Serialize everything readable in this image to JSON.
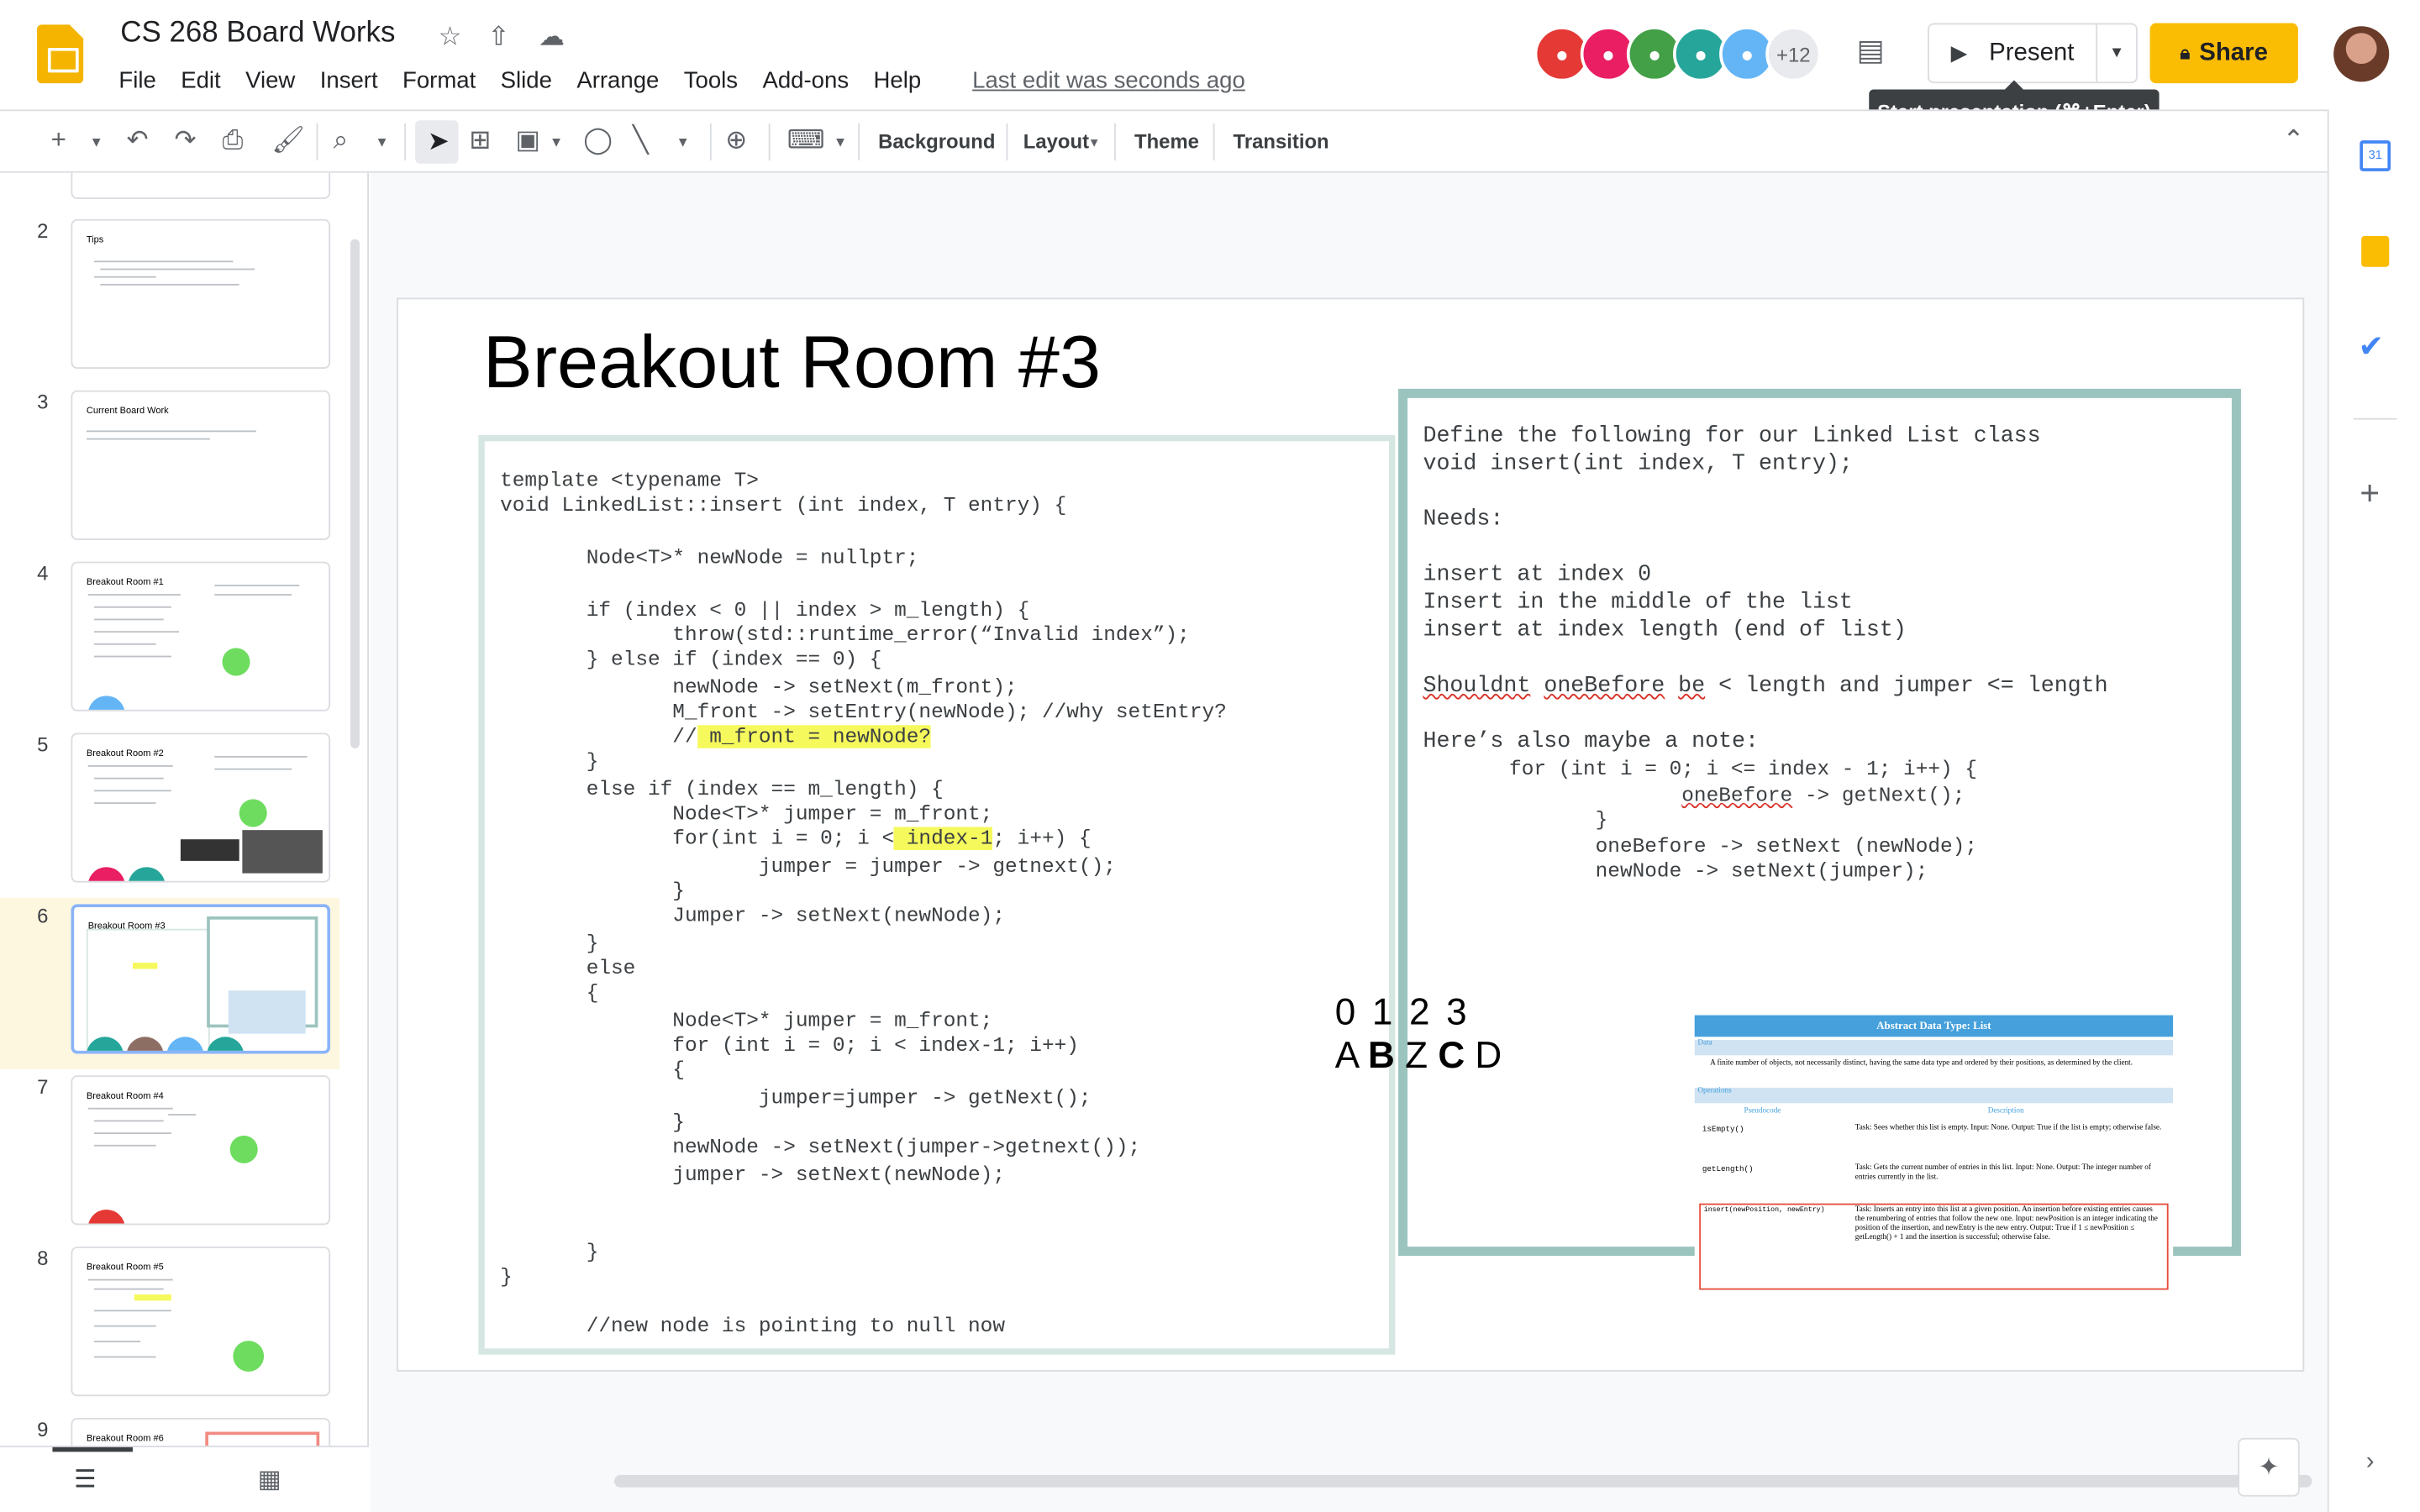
{
  "doc": {
    "title": "CS 268 Board Works",
    "last_edit": "Last edit was seconds ago"
  },
  "menu": [
    "File",
    "Edit",
    "View",
    "Insert",
    "Format",
    "Slide",
    "Arrange",
    "Tools",
    "Add-ons",
    "Help"
  ],
  "collab": {
    "more": "+12",
    "colors": [
      "#e53935",
      "#e91e63",
      "#43a047",
      "#26a69a",
      "#64b5f6"
    ]
  },
  "buttons": {
    "present": "Present",
    "share": "Share",
    "tooltip": "Start presentation (⌘+Enter)"
  },
  "toolbar": {
    "background": "Background",
    "layout": "Layout",
    "theme": "Theme",
    "transition": "Transition"
  },
  "slides": [
    {
      "num": "2",
      "title": "Tips"
    },
    {
      "num": "3",
      "title": "Current Board Work"
    },
    {
      "num": "4",
      "title": "Breakout Room #1"
    },
    {
      "num": "5",
      "title": "Breakout Room #2"
    },
    {
      "num": "6",
      "title": "Breakout Room #3"
    },
    {
      "num": "7",
      "title": "Breakout Room #4"
    },
    {
      "num": "8",
      "title": "Breakout Room #5"
    },
    {
      "num": "9",
      "title": "Breakout Room #6"
    }
  ],
  "slide": {
    "title": "Breakout Room #3",
    "code": [
      "template <typename T>",
      "void LinkedList::insert (int index, T entry) {",
      "",
      "       Node<T>* newNode = nullptr;",
      "",
      "       if (index < 0 || index > m_length) {",
      "              throw(std::runtime_error(“Invalid index”);",
      "       } else if (index == 0) {",
      "              newNode -> setNext(m_front);",
      "              M_front -> setEntry(newNode); //why setEntry?",
      "              //",
      "       }",
      "       else if (index == m_length) {",
      "              Node<T>* jumper = m_front;",
      "              for(int i = 0; i <",
      "                     jumper = jumper -> getnext();",
      "              }",
      "              Jumper -> setNext(newNode);",
      "       }",
      "       else",
      "       {",
      "              Node<T>* jumper = m_front;",
      "              for (int i = 0; i < index-1; i++)",
      "              {",
      "                     jumper=jumper -> getNext();",
      "              }",
      "              newNode -> setNext(jumper->getnext());",
      "              jumper -> setNext(newNode);",
      "",
      "",
      "       }",
      "}",
      "",
      "       //new node is pointing to null now"
    ],
    "hl1": " m_front = newNode?",
    "hl2": " index-1",
    "hl2_after": "; i++) {",
    "right": [
      "Define the following for our Linked List class",
      "void insert(int index, T entry);",
      "",
      "Needs:",
      "",
      "insert at index 0",
      "Insert in the middle of the list",
      "insert at index length (end of list)",
      "",
      "",
      "",
      "Here’s also maybe a note:",
      "       for (int i = 0; i <= index - 1; i++) {",
      "",
      "              }",
      "              oneBefore -> setNext (newNode);",
      "              newNode -> setNext(jumper);"
    ],
    "shouldnt": {
      "a": "Shouldnt",
      "b": " ",
      "c": "oneBefore",
      "d": " ",
      "e": "be",
      "f": " < length and jumper <= length"
    },
    "onebefore_line": {
      "pre": "                     ",
      "word": "oneBefore",
      "post": " -> getNext();"
    },
    "numbers": "0 1 2  3",
    "letters": [
      "A",
      "B",
      "Z",
      "C",
      "D"
    ],
    "adt": {
      "title": "Abstract Data Type: List",
      "data_label": "Data",
      "data_text": "A finite number of objects, not necessarily distinct, having the same data type and ordered by their positions, as determined by the client.",
      "ops_label": "Operations",
      "col1": "Pseudocode",
      "col2": "Description",
      "rows": [
        {
          "op": "isEmpty()",
          "desc": "Task: Sees whether this list is empty. Input: None. Output: True if the list is empty; otherwise false."
        },
        {
          "op": "getLength()",
          "desc": "Task: Gets the current number of entries in this list. Input: None. Output: The integer number of entries currently in the list."
        },
        {
          "op": "insert(newPosition, newEntry)",
          "desc": "Task: Inserts an entry into this list at a given position. An insertion before existing entries causes the renumbering of entries that follow the new one. Input: newPosition is an integer indicating the position of the insertion, and newEntry is the new entry. Output: True if 1 ≤ newPosition ≤ getLength() + 1 and the insertion is successful; otherwise false."
        }
      ]
    }
  }
}
